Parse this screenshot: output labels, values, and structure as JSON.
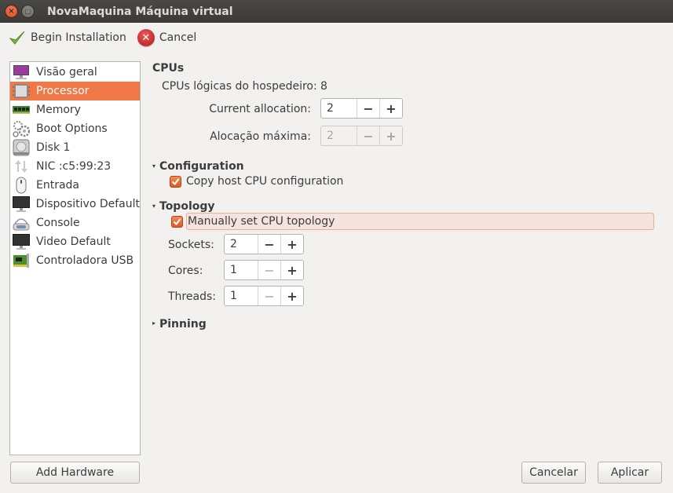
{
  "window": {
    "title": "NovaMaquina Máquina virtual",
    "close_glyph": "×",
    "maximize_glyph": "□"
  },
  "toolbar": {
    "begin_label": "Begin Installation",
    "cancel_label": "Cancel",
    "cancel_glyph": "✕"
  },
  "sidebar": {
    "items": [
      {
        "label": "Visão geral",
        "icon": "monitor-overview-icon"
      },
      {
        "label": "Processor",
        "icon": "cpu-chip-icon",
        "selected": true
      },
      {
        "label": "Memory",
        "icon": "memory-module-icon"
      },
      {
        "label": "Boot Options",
        "icon": "gears-icon"
      },
      {
        "label": "Disk 1",
        "icon": "hard-disk-icon"
      },
      {
        "label": "NIC :c5:99:23",
        "icon": "network-arrows-icon"
      },
      {
        "label": "Entrada",
        "icon": "mouse-icon"
      },
      {
        "label": "Dispositivo Default",
        "icon": "display-icon"
      },
      {
        "label": "Console",
        "icon": "serial-console-icon"
      },
      {
        "label": "Video Default",
        "icon": "display-icon"
      },
      {
        "label": "Controladora USB",
        "icon": "usb-controller-icon"
      }
    ],
    "add_hardware_label": "Add Hardware"
  },
  "cpus": {
    "heading": "CPUs",
    "host_label": "CPUs lógicas do hospedeiro:",
    "host_value": "8",
    "current_label": "Current allocation:",
    "current_value": "2",
    "max_label": "Alocação máxima:",
    "max_value": "2",
    "minus": "−",
    "plus": "+"
  },
  "configuration": {
    "heading": "Configuration",
    "copy_host_label": "Copy host CPU configuration",
    "copy_host_checked": true,
    "expander": "▾"
  },
  "topology": {
    "heading": "Topology",
    "manual_label": "Manually set CPU topology",
    "manual_checked": true,
    "expander": "▾",
    "sockets_label": "Sockets:",
    "sockets_value": "2",
    "cores_label": "Cores:",
    "cores_value": "1",
    "threads_label": "Threads:",
    "threads_value": "1"
  },
  "pinning": {
    "heading": "Pinning",
    "expander": "▸"
  },
  "footer": {
    "cancel_label": "Cancelar",
    "apply_label": "Aplicar"
  }
}
